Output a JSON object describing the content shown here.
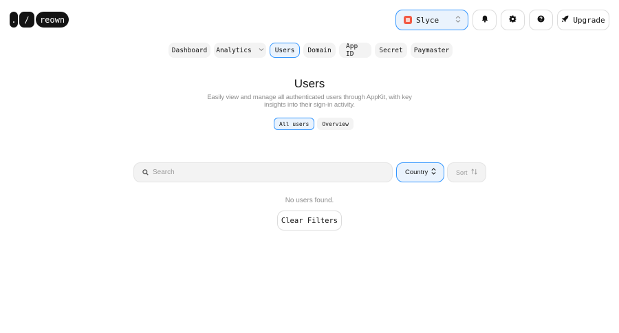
{
  "logo": {
    "seg1": ".",
    "seg2": "/",
    "seg3": "reown"
  },
  "topbar": {
    "project_name": "Slyce",
    "upgrade_label": "Upgrade",
    "icons": [
      "bell-icon",
      "gear-icon",
      "help-icon",
      "rocket-icon"
    ]
  },
  "nav": {
    "tabs": [
      {
        "label": "Dashboard",
        "active": false
      },
      {
        "label": "Analytics",
        "active": false
      },
      {
        "label": "Users",
        "active": true
      },
      {
        "label": "Domain",
        "active": false
      },
      {
        "label": "App ID",
        "active": false
      },
      {
        "label": "Secret",
        "active": false
      },
      {
        "label": "Paymaster",
        "active": false
      }
    ]
  },
  "header": {
    "title": "Users",
    "description": "Easily view and manage all authenticated users through AppKit, with key insights into their sign-in activity."
  },
  "view_toggle": {
    "all_users": "All users",
    "overview": "Overview",
    "selected": "All users"
  },
  "filters": {
    "search_placeholder": "Search",
    "country_label": "Country",
    "sort_label": "Sort"
  },
  "empty_state": {
    "message": "No users found.",
    "clear_label": "Clear Filters"
  },
  "colors": {
    "accent": "#3396ff",
    "accent_bg": "#eaf3fd",
    "text": "#141414",
    "muted": "#8c8c8c",
    "project_avatar": "#f25a45"
  }
}
